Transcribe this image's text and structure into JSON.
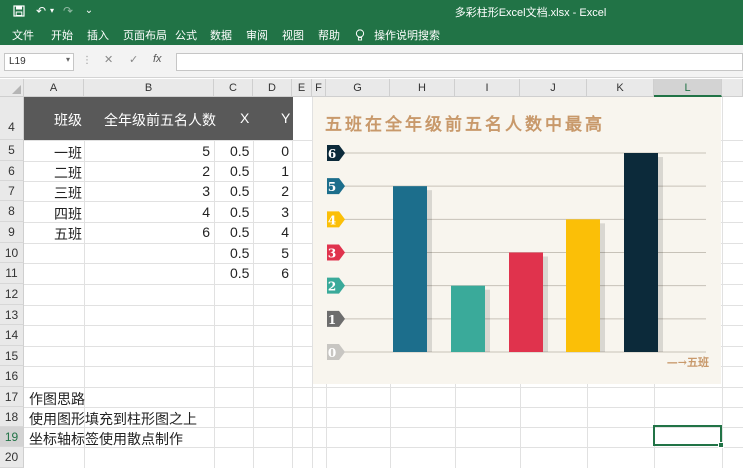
{
  "window": {
    "title": "多彩柱形Excel文档.xlsx  -  Excel",
    "quick_access": {
      "undo": "↶",
      "redo": "↷",
      "more": "⌄"
    }
  },
  "ribbon": {
    "tabs": [
      "文件",
      "开始",
      "插入",
      "页面布局",
      "公式",
      "数据",
      "审阅",
      "视图",
      "帮助"
    ],
    "tell_me": "操作说明搜索"
  },
  "formula_bar": {
    "name_box": "L19",
    "formula": "",
    "cancel": "✕",
    "enter": "✓",
    "fx": "fx"
  },
  "columns": [
    "A",
    "B",
    "C",
    "D",
    "E",
    "F",
    "G",
    "H",
    "I",
    "J",
    "K",
    "L"
  ],
  "rows": [
    "4",
    "5",
    "6",
    "7",
    "8",
    "9",
    "10",
    "11",
    "12",
    "13",
    "14",
    "15",
    "16",
    "17",
    "18",
    "19",
    "20"
  ],
  "selected": {
    "column": "L",
    "row": "19"
  },
  "table": {
    "headers": [
      "班级",
      "全年级前五名人数",
      "X",
      "Y"
    ],
    "classes": [
      "一班",
      "二班",
      "三班",
      "四班",
      "五班"
    ],
    "counts": [
      "5",
      "2",
      "3",
      "4",
      "6"
    ],
    "x": [
      "0.5",
      "0.5",
      "0.5",
      "0.5",
      "0.5",
      "0.5",
      "0.5"
    ],
    "y": [
      "0",
      "1",
      "2",
      "3",
      "4",
      "5",
      "6"
    ]
  },
  "notes": [
    "作图思路",
    "使用图形填充到柱形图之上",
    "坐标轴标签使用散点制作"
  ],
  "chart_data": {
    "type": "bar",
    "title": "五班在全年级前五名人数中最高",
    "categories": [
      "一班",
      "二班",
      "三班",
      "四班",
      "五班"
    ],
    "values": [
      5,
      2,
      3,
      4,
      6
    ],
    "ylim": [
      0,
      6
    ],
    "y_ticks": [
      "0",
      "1",
      "2",
      "3",
      "4",
      "5",
      "6"
    ],
    "footnote": "—→五班",
    "bar_colors": [
      "#1c6e8c",
      "#3aaa9a",
      "#e0334d",
      "#fbbf07",
      "#0c2a3a"
    ],
    "tick_colors": [
      "#c8c6c2",
      "#6d6d6d",
      "#3aaa9a",
      "#e0334d",
      "#fbbf07",
      "#1c6e8c",
      "#0c2a3a"
    ],
    "grid": true,
    "background": "#f8f5ee"
  },
  "theme": {
    "excel_green": "#217346",
    "header_band": "#595959"
  }
}
